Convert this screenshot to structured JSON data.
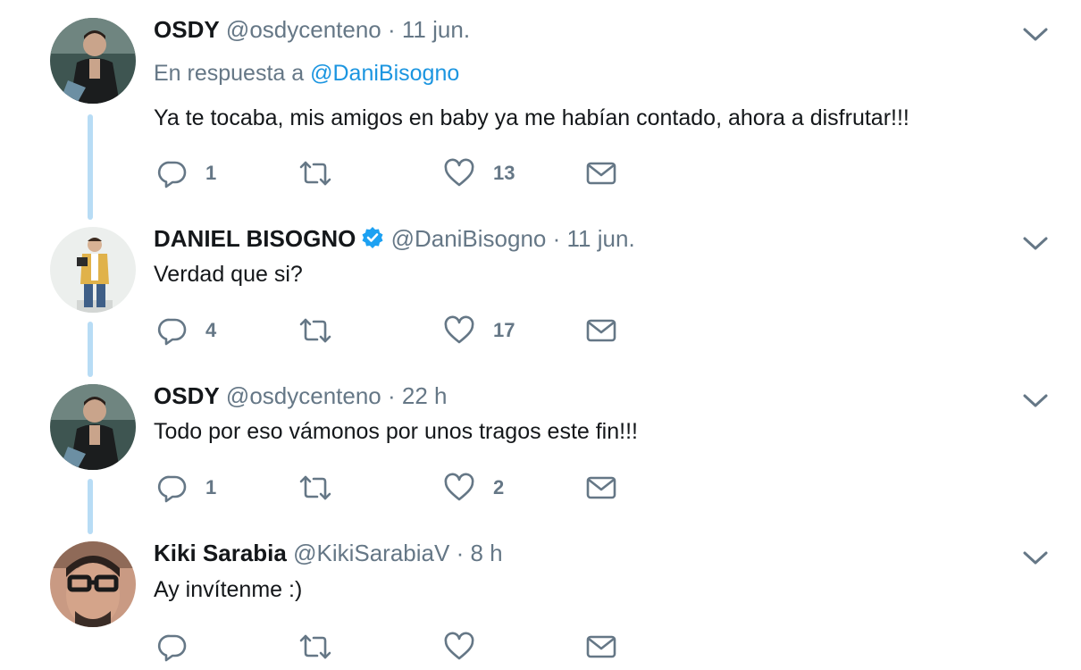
{
  "tweets": [
    {
      "name": "OSDY",
      "handle": "@osdycenteno",
      "separator": "·",
      "time": "11 jun.",
      "reply_prefix": "En respuesta a",
      "reply_to": "@DaniBisogno",
      "text": "Ya te tocaba, mis amigos en baby ya me habían contado, ahora a disfrutar!!!",
      "replies": "1",
      "likes": "13",
      "verified": false
    },
    {
      "name": "DANIEL BISOGNO",
      "handle": "@DaniBisogno",
      "separator": "·",
      "time": "11 jun.",
      "text": "Verdad que si?",
      "replies": "4",
      "likes": "17",
      "verified": true
    },
    {
      "name": "OSDY",
      "handle": "@osdycenteno",
      "separator": "·",
      "time": "22 h",
      "text": "Todo por eso vámonos por unos tragos este fin!!!",
      "replies": "1",
      "likes": "2",
      "verified": false
    },
    {
      "name": "Kiki Sarabia",
      "handle": "@KikiSarabiaV",
      "separator": "·",
      "time": "8 h",
      "text": "Ay invítenme :)",
      "replies": "",
      "likes": "",
      "verified": false
    }
  ],
  "colors": {
    "accent": "#1b95e0",
    "verified": "#1da1f2",
    "muted": "#657786",
    "thread_line": "#b8dcf5"
  },
  "icons": {
    "reply": "reply-icon",
    "retweet": "retweet-icon",
    "like": "heart-icon",
    "dm": "envelope-icon",
    "more": "chevron-down-icon",
    "verified": "verified-badge-icon"
  }
}
